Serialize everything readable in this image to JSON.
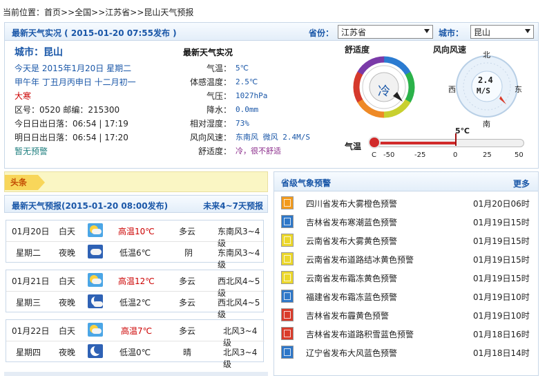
{
  "breadcrumb": {
    "prefix": "当前位置：",
    "home": "首页",
    "sep": ">>",
    "nation": "全国",
    "province": "江苏省",
    "page": "昆山天气预报"
  },
  "live": {
    "header_title": "最新天气实况 ( 2015-01-20  07:55发布 )",
    "province_label": "省份：",
    "province_value": "江苏省",
    "city_label": "城市：",
    "city_value": "昆山",
    "city_title": "城市：昆山",
    "today": "今天是 2015年1月20日 星期二",
    "lunar": "甲午年 丁丑月丙申日 十二月初一",
    "solar_term": "大寒",
    "code_line": "区号：0520   邮编：215300",
    "sun_today": "今日日出日落：06:54 | 17:19",
    "sun_tomorrow": "明日日出日落：06:54 | 17:20",
    "warning": "暂无预警",
    "mid_title": "最新天气实况",
    "rows": [
      {
        "k": "气温：",
        "v": "5℃"
      },
      {
        "k": "体感温度：",
        "v": "2.5℃"
      },
      {
        "k": "气压：",
        "v": "1027hPa"
      },
      {
        "k": "降水：",
        "v": "0.0mm"
      },
      {
        "k": "相对湿度：",
        "v": "73%"
      },
      {
        "k": "风向风速：",
        "v": "东南风 微风 2.4M/S"
      }
    ],
    "comfort_row_k": "舒适度：",
    "comfort_row_v": "冷，很不舒适",
    "comfort_label": "舒适度",
    "comfort_value": "冷",
    "wind_label": "风向风速",
    "wind_speed": "2.4",
    "wind_unit": "M/S",
    "compass": {
      "n": "北",
      "s": "南",
      "e": "东",
      "w": "西"
    },
    "temp_label": "气温",
    "temp_value": "5℃",
    "temp_ticks": [
      "-50",
      "-25",
      "0",
      "25",
      "50"
    ],
    "temp_unit": "C",
    "temp_reading": 5
  },
  "headline": {
    "tag": "头条"
  },
  "forecast": {
    "title": "最新天气预报(2015-01-20  08:00发布)",
    "link": "未来4~7天预报",
    "days": [
      {
        "date": "01月20日",
        "weekday": "星期二",
        "day": {
          "period": "白天",
          "temp": "高温10℃",
          "weather": "多云",
          "wind": "东南风3~4级"
        },
        "night": {
          "period": "夜晚",
          "temp": "低温6℃",
          "weather": "阴",
          "wind": "东南风3~4级"
        }
      },
      {
        "date": "01月21日",
        "weekday": "星期三",
        "day": {
          "period": "白天",
          "temp": "高温12℃",
          "weather": "多云",
          "wind": "西北风4~5级"
        },
        "night": {
          "period": "夜晚",
          "temp": "低温2℃",
          "weather": "多云",
          "wind": "西北风4~5级"
        }
      },
      {
        "date": "01月22日",
        "weekday": "星期四",
        "day": {
          "period": "白天",
          "temp": "高温7℃",
          "weather": "多云",
          "wind": "北风3~4级"
        },
        "night": {
          "period": "夜晚",
          "temp": "低温0℃",
          "weather": "晴",
          "wind": "北风3~4级"
        }
      }
    ]
  },
  "alerts": {
    "title": "省级气象预警",
    "more": "更多",
    "items": [
      {
        "text": "四川省发布大雾橙色预警",
        "date": "01月20日06时",
        "color": "orange"
      },
      {
        "text": "吉林省发布寒潮蓝色预警",
        "date": "01月19日15时",
        "color": "blue"
      },
      {
        "text": "云南省发布大雾黄色预警",
        "date": "01月19日15时",
        "color": "yellow"
      },
      {
        "text": "云南省发布道路结冰黄色预警",
        "date": "01月19日15时",
        "color": "yellow"
      },
      {
        "text": "云南省发布霜冻黄色预警",
        "date": "01月19日15时",
        "color": "yellow"
      },
      {
        "text": "福建省发布霜冻蓝色预警",
        "date": "01月19日10时",
        "color": "blue"
      },
      {
        "text": "吉林省发布霾黄色预警",
        "date": "01月19日10时",
        "color": "red"
      },
      {
        "text": "吉林省发布道路积雪蓝色预警",
        "date": "01月18日16时",
        "color": "red"
      },
      {
        "text": "辽宁省发布大风蓝色预警",
        "date": "01月18日14时",
        "color": "blue"
      }
    ]
  }
}
